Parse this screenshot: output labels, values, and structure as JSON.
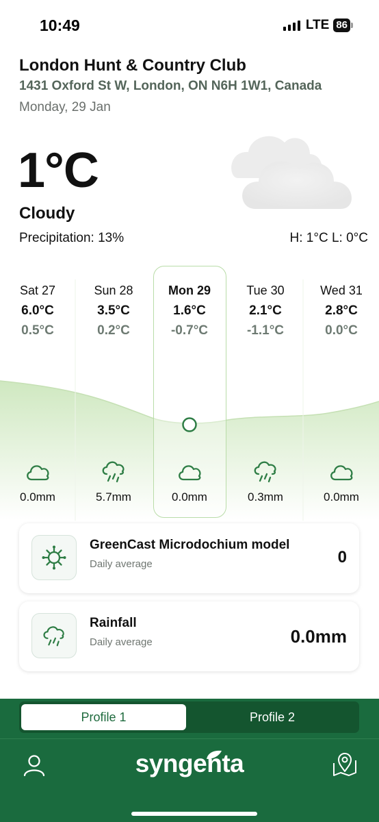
{
  "status_bar": {
    "time": "10:49",
    "network": "LTE",
    "battery": "86"
  },
  "header": {
    "club_name": "London Hunt & Country Club",
    "address": "1431 Oxford St W, London, ON N6H 1W1, Canada",
    "date": "Monday, 29 Jan"
  },
  "current": {
    "temperature": "1°C",
    "condition": "Cloudy",
    "precipitation": "Precipitation: 13%",
    "high_low": "H: 1°C  L: 0°C"
  },
  "forecast": [
    {
      "day": "Sat 27",
      "high": "6.0°C",
      "low": "0.5°C",
      "icon": "cloud-icon",
      "rain": "0.0mm"
    },
    {
      "day": "Sun 28",
      "high": "3.5°C",
      "low": "0.2°C",
      "icon": "rain-icon",
      "rain": "5.7mm"
    },
    {
      "day": "Mon 29",
      "high": "1.6°C",
      "low": "-0.7°C",
      "icon": "cloud-icon",
      "rain": "0.0mm",
      "selected": true
    },
    {
      "day": "Tue 30",
      "high": "2.1°C",
      "low": "-1.1°C",
      "icon": "rain-icon",
      "rain": "0.3mm"
    },
    {
      "day": "Wed 31",
      "high": "2.8°C",
      "low": "0.0°C",
      "icon": "cloud-icon",
      "rain": "0.0mm"
    }
  ],
  "cards": {
    "microdochium": {
      "title": "GreenCast Microdochium model",
      "subtitle": "Daily average",
      "value": "0",
      "icon": "virus-icon"
    },
    "rainfall": {
      "title": "Rainfall",
      "subtitle": "Daily average",
      "value": "0.0mm",
      "icon": "rain-cloud-icon"
    }
  },
  "bottom_nav": {
    "tabs": [
      "Profile 1",
      "Profile 2"
    ],
    "active_tab": "Profile 1",
    "logo": "syngenta",
    "left_icon": "profile-icon",
    "right_icon": "map-pin-icon"
  },
  "colors": {
    "brand_green": "#1a6b3e",
    "accent_green": "#2e7d45",
    "chart_fill": "#cfe8c0"
  }
}
